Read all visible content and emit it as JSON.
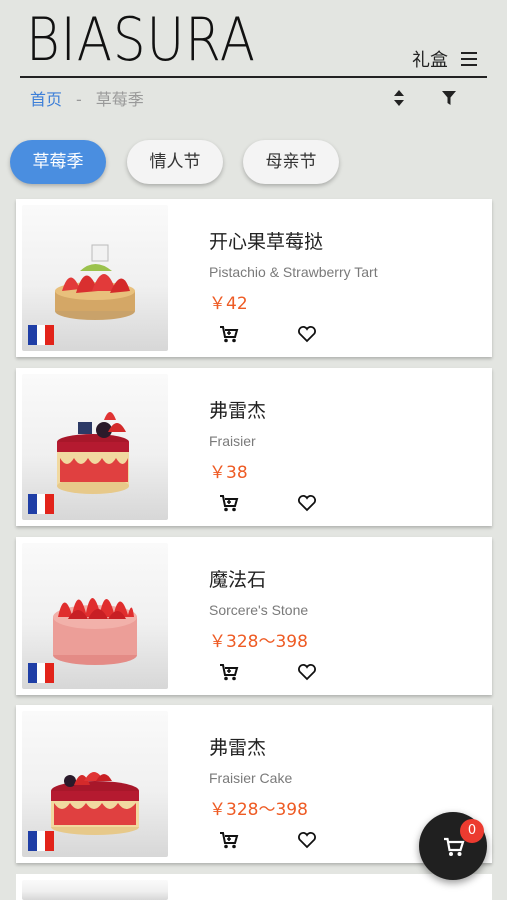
{
  "brand": {
    "logo": "BIASURA"
  },
  "header": {
    "gift_box": "礼盒"
  },
  "breadcrumb": {
    "home": "首页",
    "separator": "-",
    "current": "草莓季"
  },
  "tabs": [
    {
      "label": "草莓季",
      "active": true
    },
    {
      "label": "情人节",
      "active": false
    },
    {
      "label": "母亲节",
      "active": false
    }
  ],
  "products": [
    {
      "name_cn": "开心果草莓挞",
      "name_en": "Pistachio & Strawberry Tart",
      "price": "￥42",
      "origin_flag": "france-flag"
    },
    {
      "name_cn": "弗雷杰",
      "name_en": "Fraisier",
      "price": "￥38",
      "origin_flag": "france-flag"
    },
    {
      "name_cn": "魔法石",
      "name_en": "Sorcere's Stone",
      "price": "￥328～398",
      "origin_flag": "france-flag"
    },
    {
      "name_cn": "弗雷杰",
      "name_en": "Fraisier Cake",
      "price": "￥328～398",
      "origin_flag": "france-flag"
    }
  ],
  "cart": {
    "count": "0"
  },
  "colors": {
    "accent": "#4a8ee0",
    "price": "#ee5b24",
    "badge": "#ec3b30",
    "background": "#e3e5e1"
  }
}
